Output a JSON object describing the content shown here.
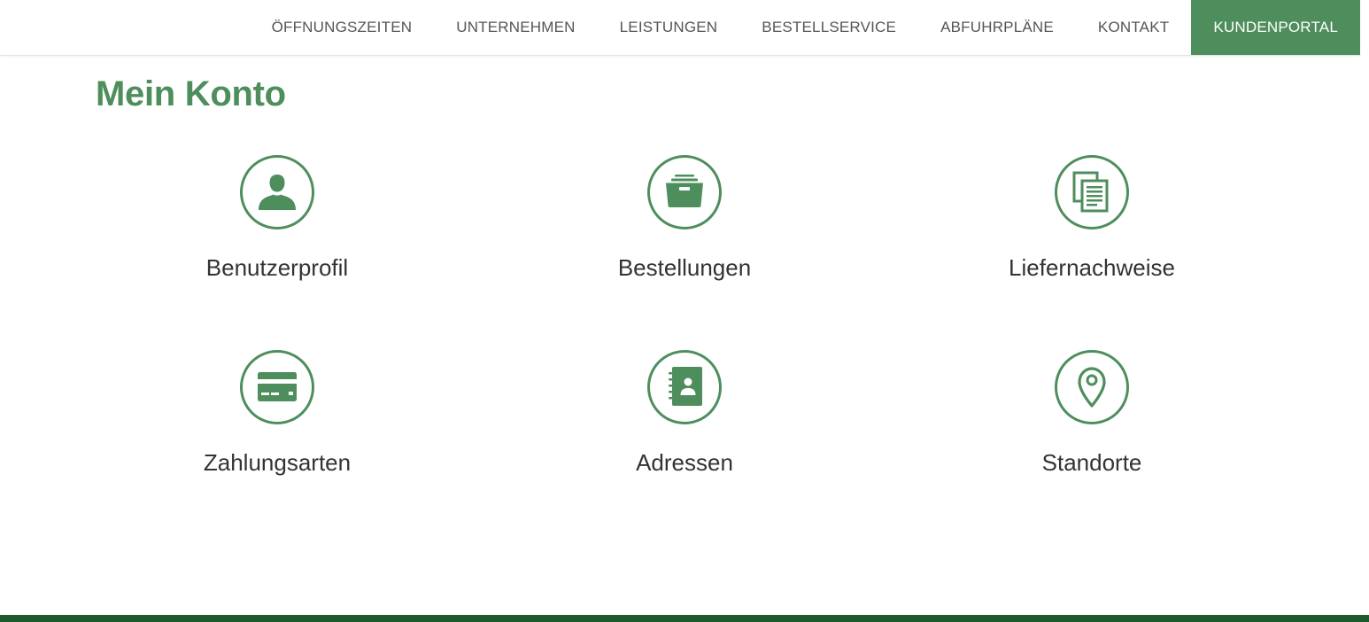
{
  "nav": {
    "items": [
      {
        "label": "ÖFFNUNGSZEITEN"
      },
      {
        "label": "UNTERNEHMEN"
      },
      {
        "label": "LEISTUNGEN"
      },
      {
        "label": "BESTELLSERVICE"
      },
      {
        "label": "ABFUHRPLÄNE"
      },
      {
        "label": "KONTAKT"
      },
      {
        "label": "KUNDENPORTAL",
        "active": true
      }
    ]
  },
  "main": {
    "title": "Mein Konto",
    "tiles": [
      {
        "label": "Benutzerprofil",
        "icon": "user-icon"
      },
      {
        "label": "Bestellungen",
        "icon": "archive-box-icon"
      },
      {
        "label": "Liefernachweise",
        "icon": "documents-icon"
      },
      {
        "label": "Zahlungsarten",
        "icon": "credit-card-icon"
      },
      {
        "label": "Adressen",
        "icon": "address-book-icon"
      },
      {
        "label": "Standorte",
        "icon": "map-pin-icon"
      }
    ]
  },
  "colors": {
    "accent": "#4e8e5c",
    "footer": "#1e5a2b",
    "text": "#333333",
    "nav_text": "#555555"
  }
}
